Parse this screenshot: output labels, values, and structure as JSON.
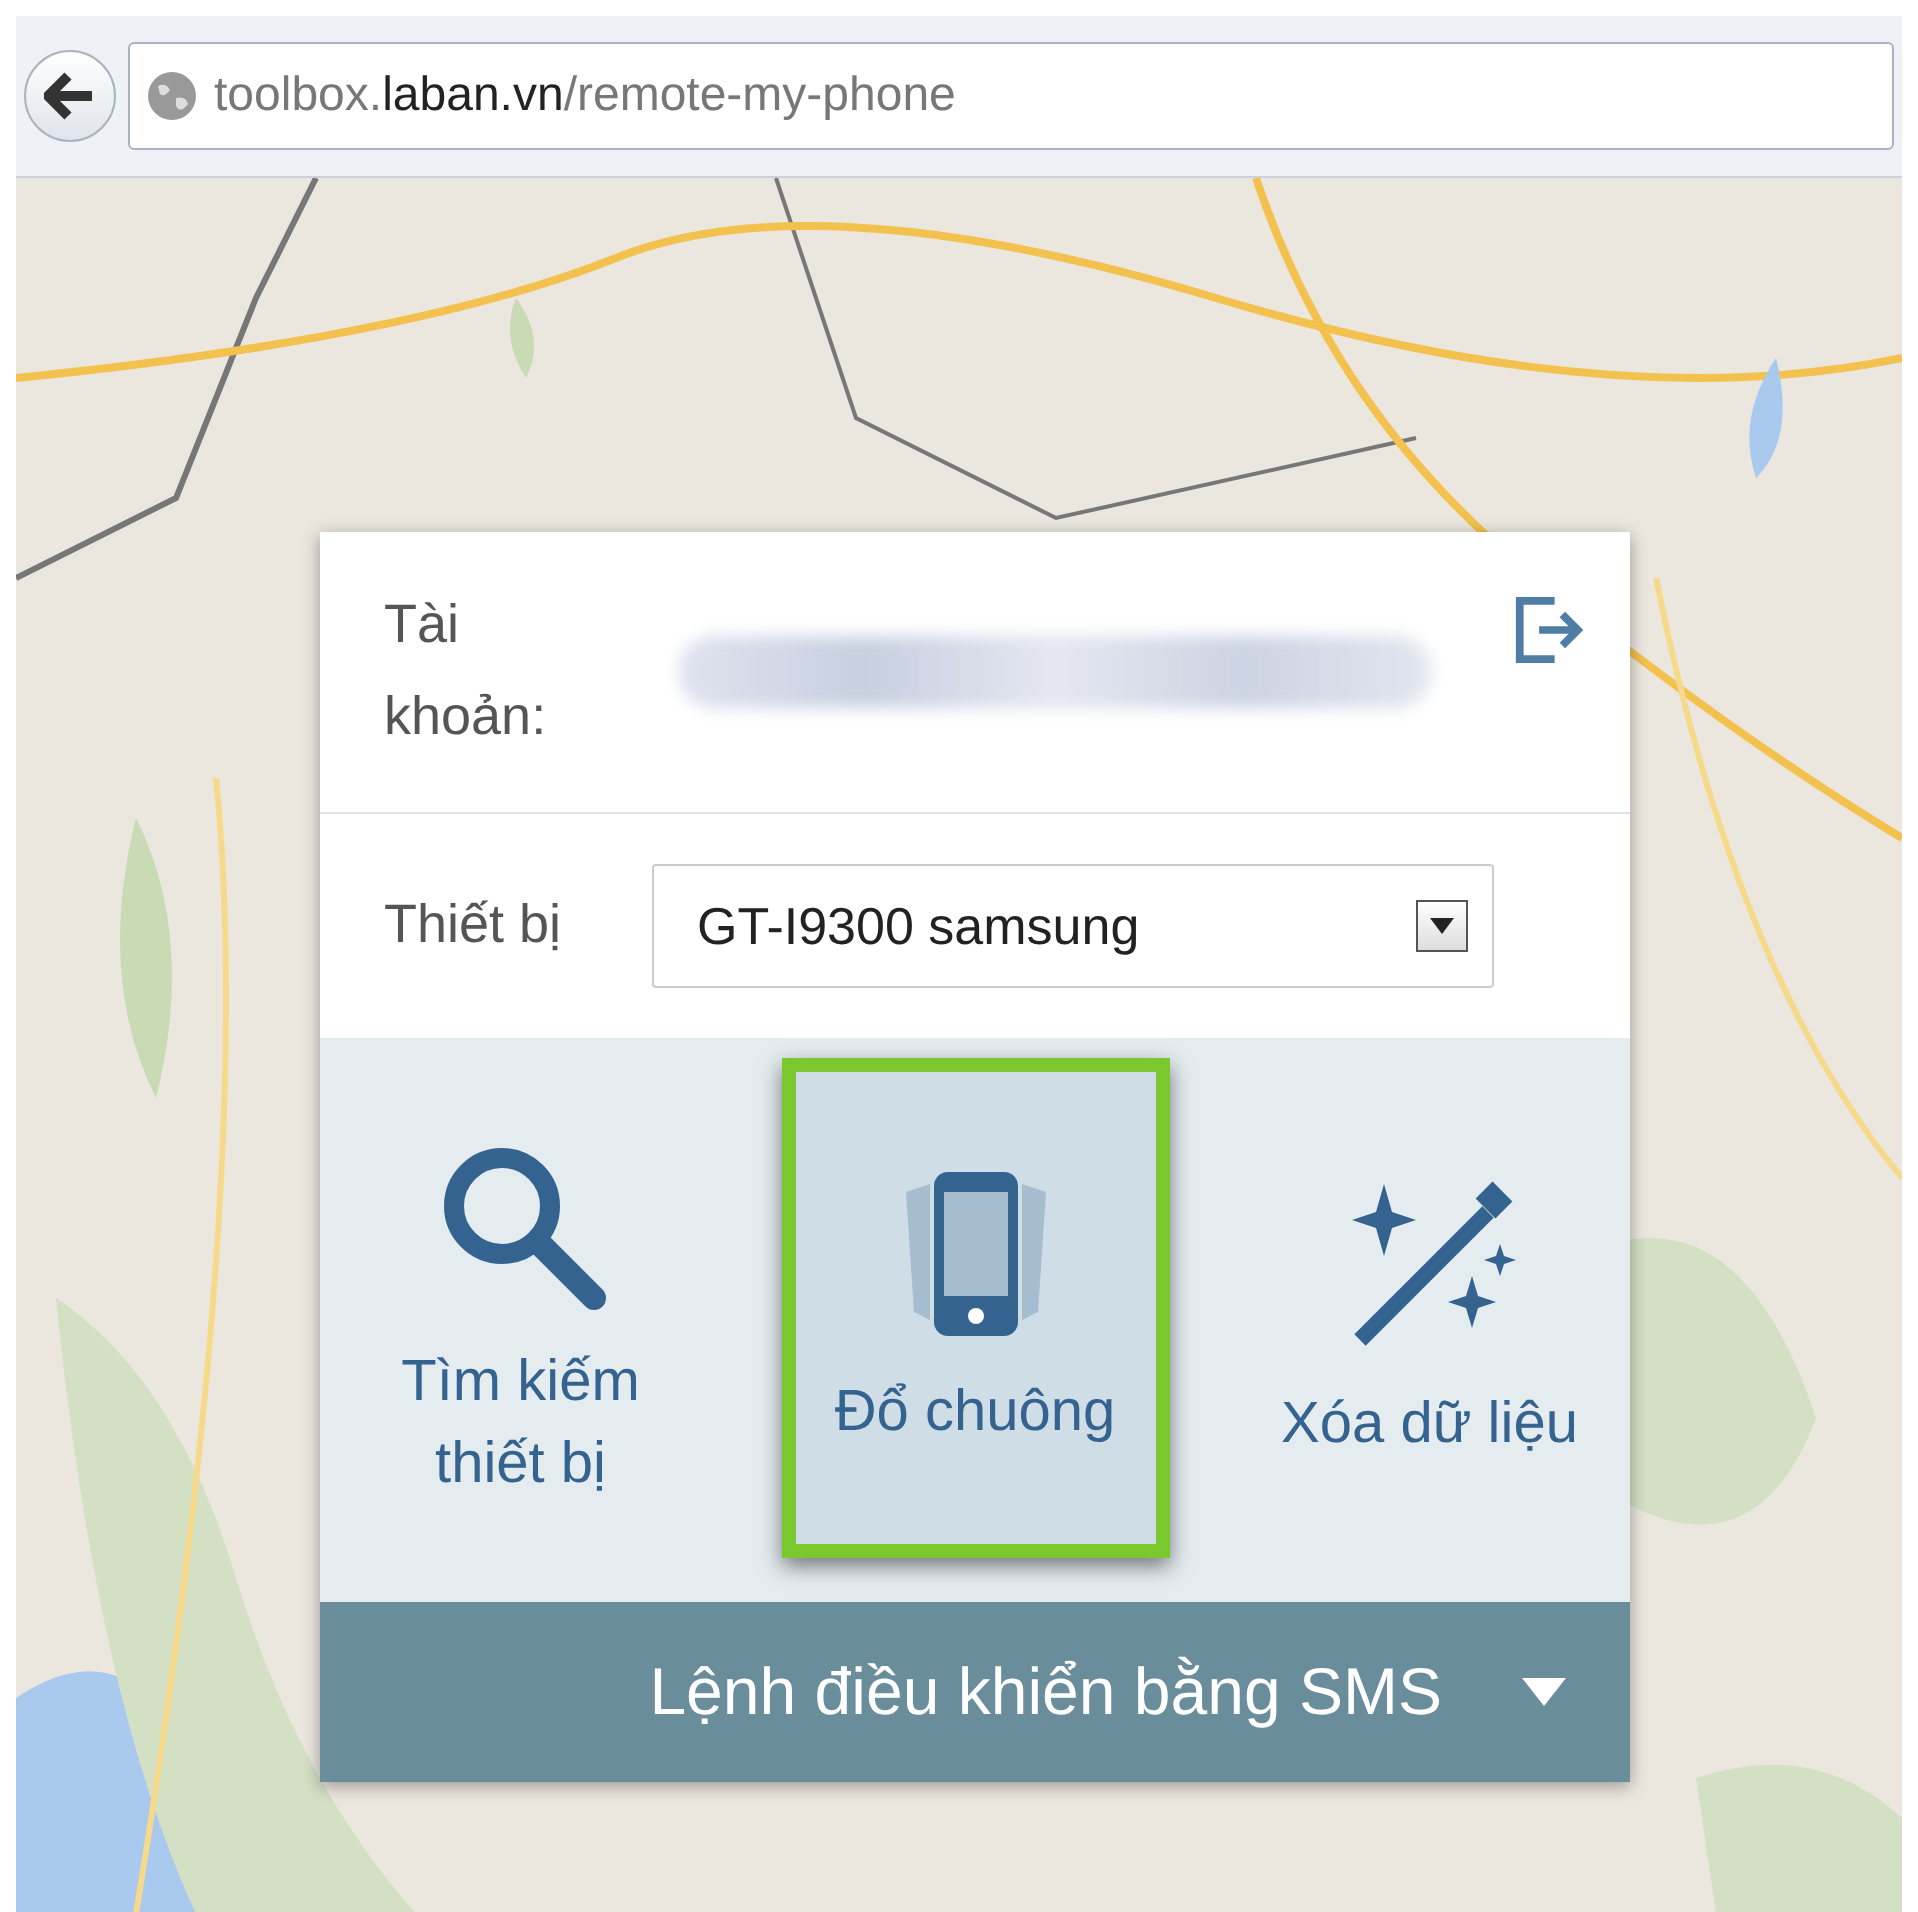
{
  "browser": {
    "url": "toolbox.**laban.vn**/remote-my-phone"
  },
  "panel": {
    "account_label": "Tài khoản:",
    "device_label": "Thiết bị",
    "device_value": "GT-I9300 samsung",
    "actions": [
      {
        "kind": "search",
        "label": "Tìm kiếm thiết bị",
        "selected": false
      },
      {
        "kind": "ring",
        "label": "Đổ chuông",
        "selected": true
      },
      {
        "kind": "wipe",
        "label": "Xóa dữ liệu",
        "selected": false
      }
    ],
    "sms_bar": {
      "label": "Lệnh điều khiển bằng SMS",
      "expanded": false
    }
  }
}
